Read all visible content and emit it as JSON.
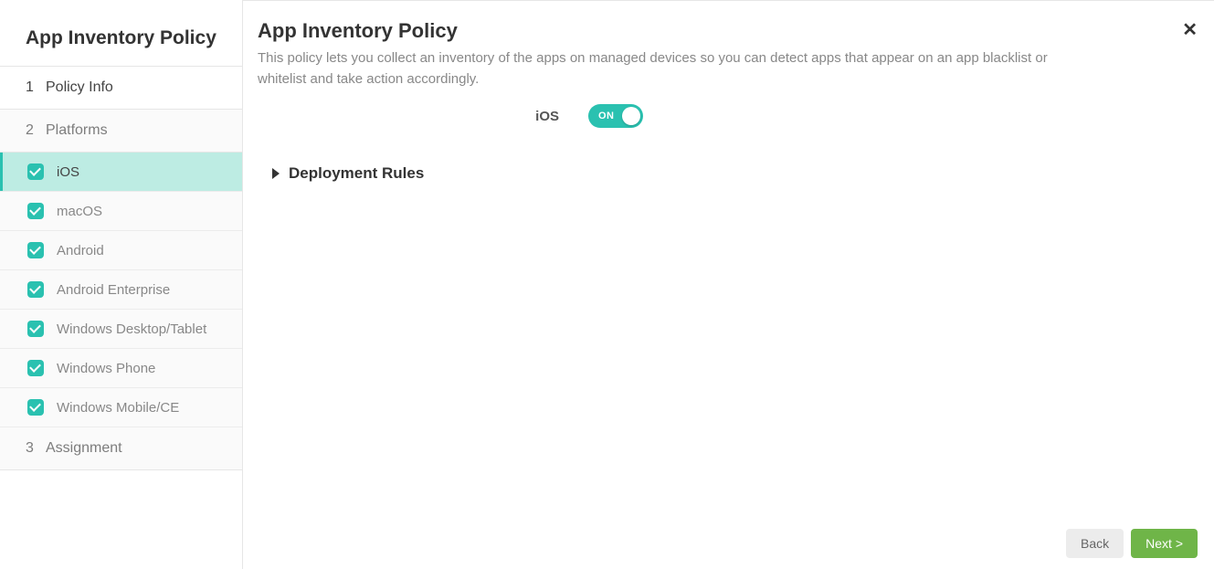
{
  "sidebar": {
    "title": "App Inventory Policy",
    "steps": [
      {
        "num": "1",
        "label": "Policy Info"
      },
      {
        "num": "2",
        "label": "Platforms"
      },
      {
        "num": "3",
        "label": "Assignment"
      }
    ],
    "platforms": [
      {
        "label": "iOS",
        "active": true
      },
      {
        "label": "macOS"
      },
      {
        "label": "Android"
      },
      {
        "label": "Android Enterprise"
      },
      {
        "label": "Windows Desktop/Tablet"
      },
      {
        "label": "Windows Phone"
      },
      {
        "label": "Windows Mobile/CE"
      }
    ]
  },
  "main": {
    "title": "App Inventory Policy",
    "description": "This policy lets you collect an inventory of the apps on managed devices so you can detect apps that appear on an app blacklist or whitelist and take action accordingly.",
    "toggle_label": "iOS",
    "toggle_state": "ON",
    "deployment_rules": "Deployment Rules"
  },
  "footer": {
    "back": "Back",
    "next": "Next >"
  }
}
